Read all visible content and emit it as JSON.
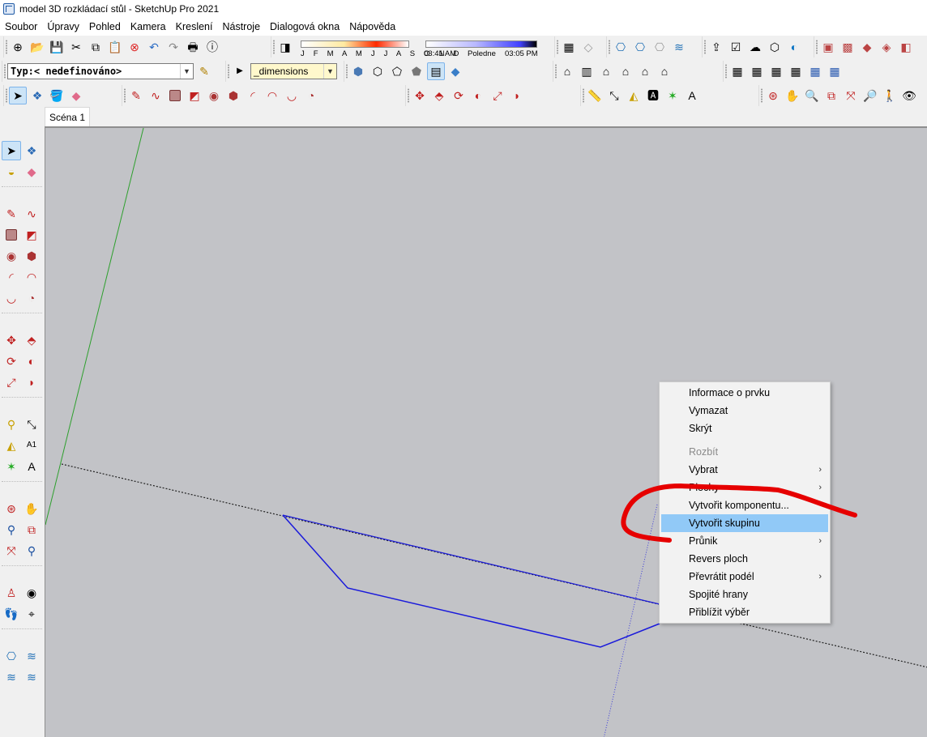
{
  "window": {
    "title": "model 3D rozkládací stůl - SketchUp Pro 2021"
  },
  "menubar": [
    "Soubor",
    "Úpravy",
    "Pohled",
    "Kamera",
    "Kreslení",
    "Nástroje",
    "Dialogová okna",
    "Nápověda"
  ],
  "toolbars": {
    "tag_select_value": "Typ:< nedefinováno>",
    "layer_select_value": "_dimensions",
    "shadows": {
      "months": "J F M A M J J A S O N D",
      "time_start": "03:41 AM",
      "time_mid": "Poledne",
      "time_end": "03:05 PM"
    }
  },
  "scene_tab": "Scéna 1",
  "context_menu": {
    "items": [
      {
        "label": "Informace o prvku"
      },
      {
        "label": "Vymazat"
      },
      {
        "label": "Skrýt"
      },
      {
        "label": "Rozbít",
        "disabled": true
      },
      {
        "label": "Vybrat",
        "submenu": true
      },
      {
        "label": "Plochy",
        "submenu": true
      },
      {
        "label": "Vytvořit komponentu..."
      },
      {
        "label": "Vytvořit skupinu",
        "highlight": true
      },
      {
        "label": "Průnik",
        "submenu": true
      },
      {
        "label": "Revers ploch"
      },
      {
        "label": "Převrátit podél",
        "submenu": true
      },
      {
        "label": "Spojité hrany"
      },
      {
        "label": "Přiblížit výběr"
      }
    ]
  },
  "colors": {
    "viewport_bg": "#c2c3c7",
    "green_axis": "#2ea02e",
    "blue_axis": "#3a3ad8",
    "selected_edges": "#1a1adb",
    "highlight": "#91c9f7",
    "annotation": "#e60000"
  }
}
